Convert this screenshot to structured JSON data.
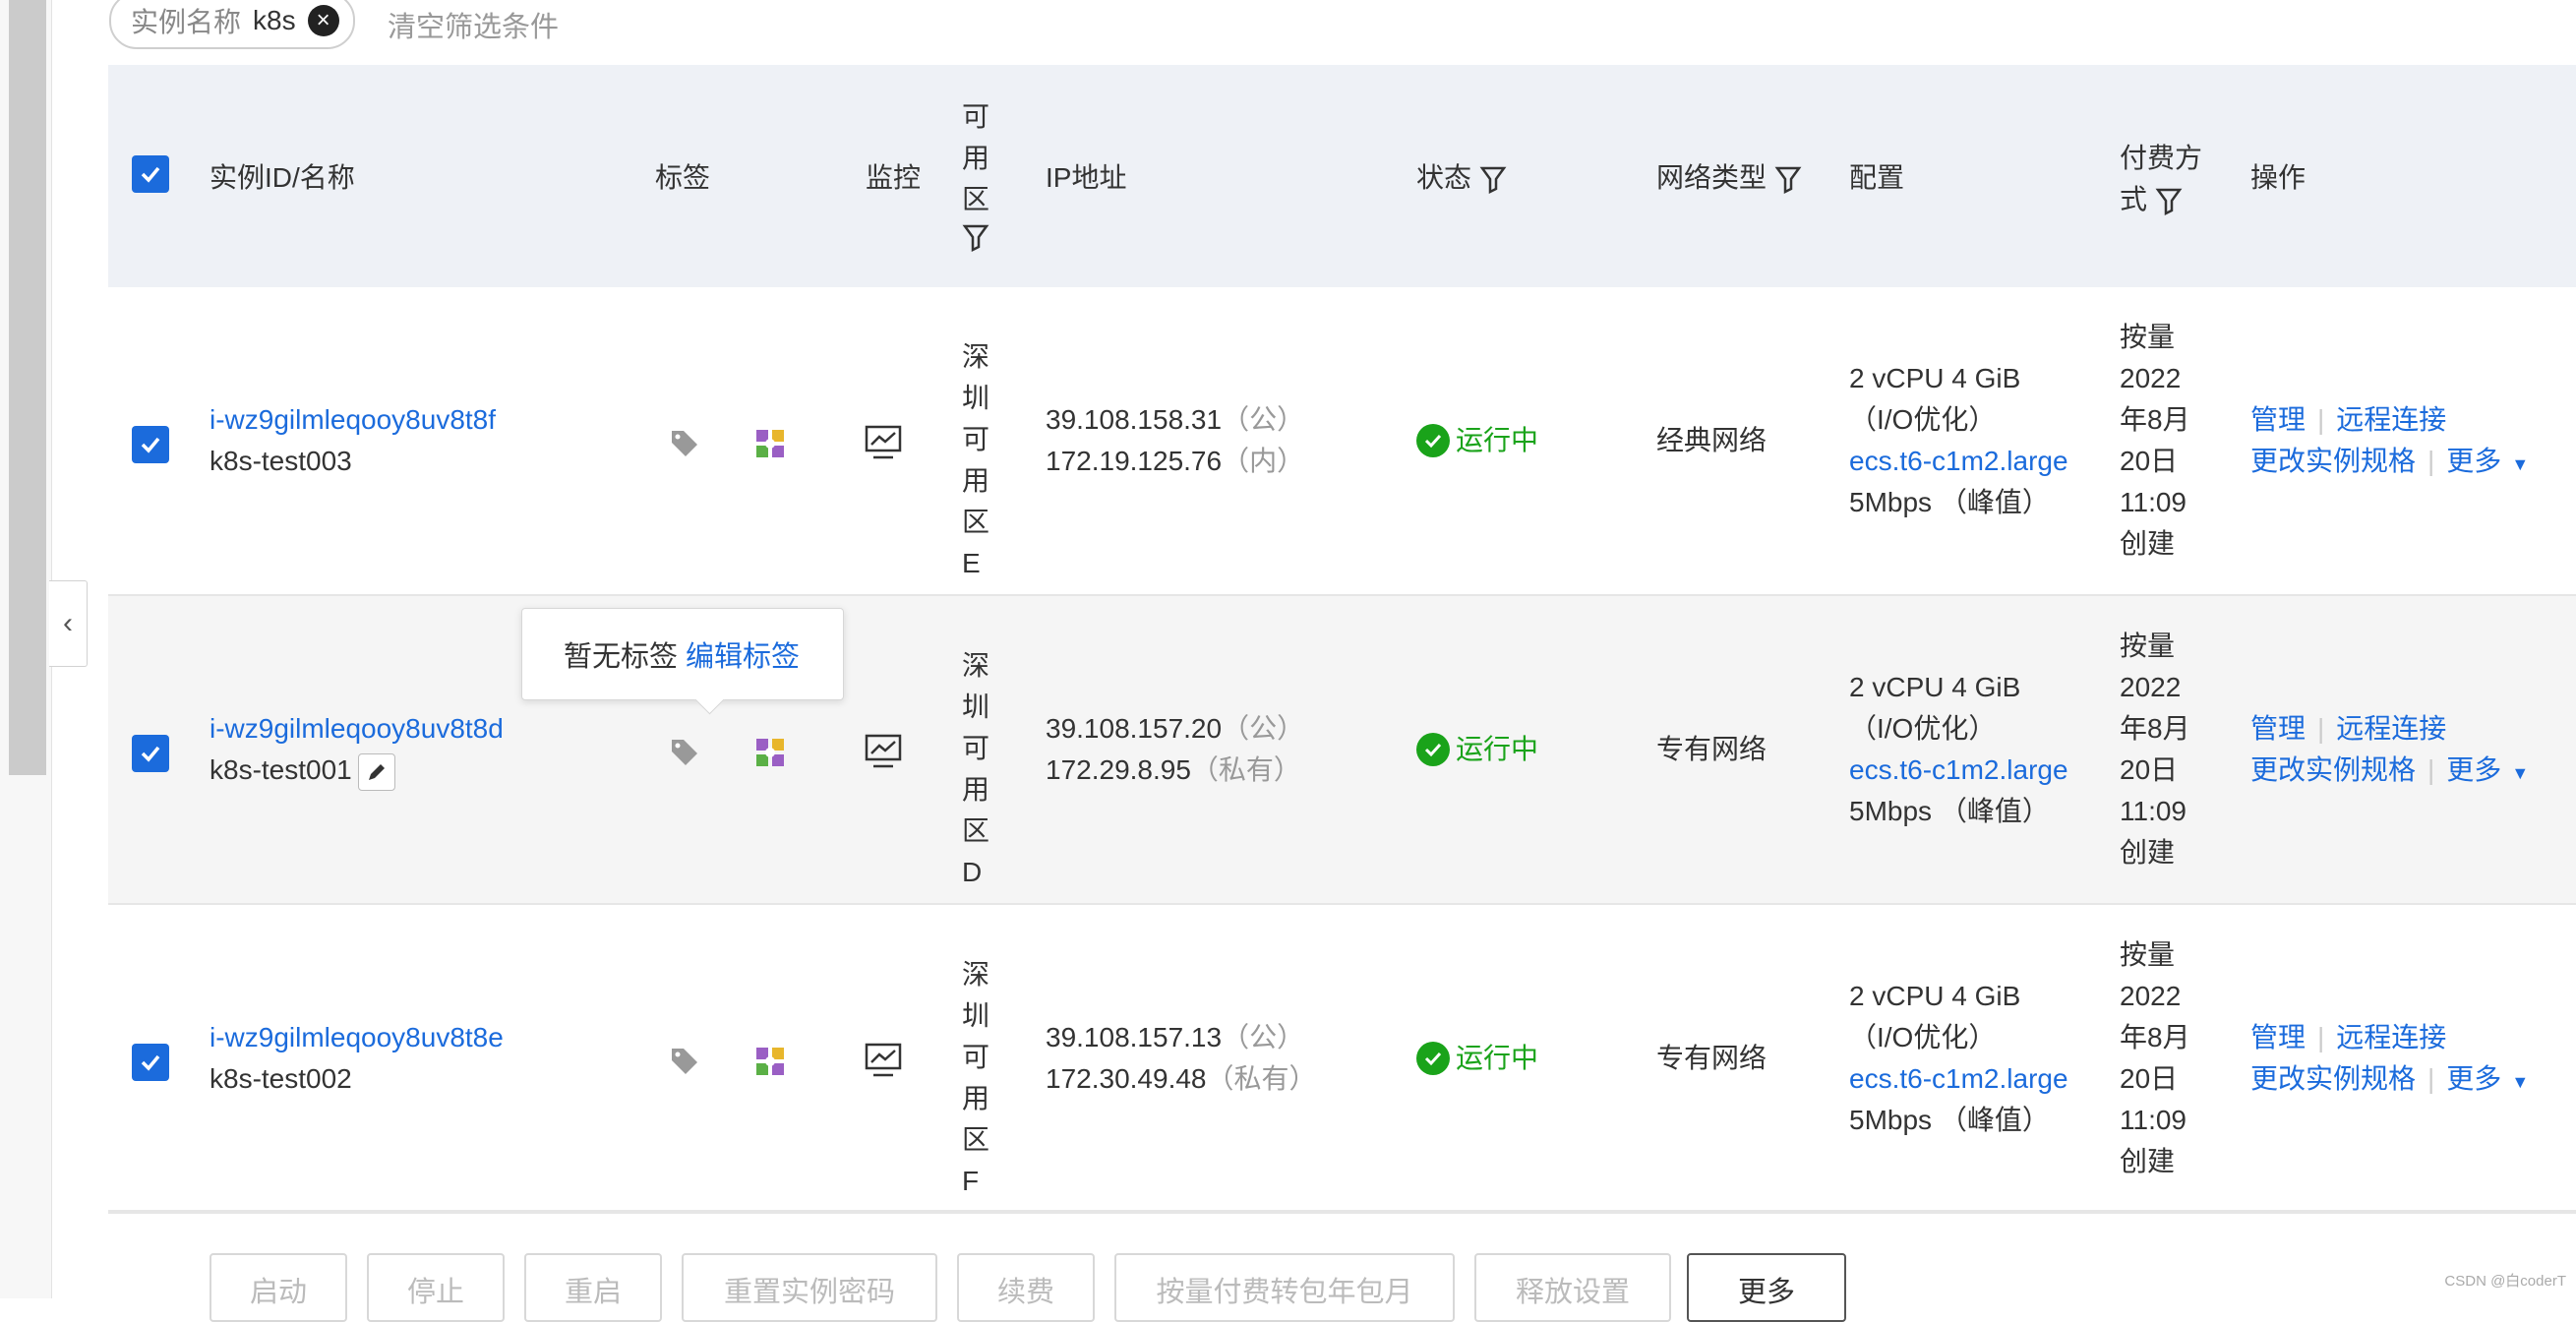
{
  "filter": {
    "key": "实例名称",
    "value": "k8s",
    "clear_label": "清空筛选条件"
  },
  "columns": {
    "id_name": "实例ID/名称",
    "tags": "标签",
    "monitor": "监控",
    "zone": "可用区",
    "ip": "IP地址",
    "status": "状态",
    "network": "网络类型",
    "config": "配置",
    "billing": "付费方式",
    "actions": "操作"
  },
  "rows": [
    {
      "id": "i-wz9gilmleqooy8uv8t8f",
      "name": "k8s-test003",
      "zone": "深圳可用区E",
      "ip_public": "39.108.158.31",
      "ip_public_tag": "（公）",
      "ip_private": "172.19.125.76",
      "ip_private_tag": "（内）",
      "status": "运行中",
      "network": "经典网络",
      "config_spec": "2 vCPU 4 GiB",
      "config_io": "（I/O优化）",
      "config_type": "ecs.t6-c1m2.large",
      "config_bw": "5Mbps （峰值）",
      "billing": "按量",
      "billing_date": "2022年8月20日",
      "billing_time": "11:09",
      "billing_created": "创建",
      "action_manage": "管理",
      "action_remote": "远程连接",
      "action_resize": "更改实例规格",
      "action_more": "更多"
    },
    {
      "id": "i-wz9gilmleqooy8uv8t8d",
      "name": "k8s-test001",
      "zone": "深圳可用区D",
      "ip_public": "39.108.157.20",
      "ip_public_tag": "（公）",
      "ip_private": "172.29.8.95",
      "ip_private_tag": "（私有）",
      "status": "运行中",
      "network": "专有网络",
      "config_spec": "2 vCPU 4 GiB",
      "config_io": "（I/O优化）",
      "config_type": "ecs.t6-c1m2.large",
      "config_bw": "5Mbps （峰值）",
      "billing": "按量",
      "billing_date": "2022年8月20日",
      "billing_time": "11:09",
      "billing_created": "创建",
      "action_manage": "管理",
      "action_remote": "远程连接",
      "action_resize": "更改实例规格",
      "action_more": "更多"
    },
    {
      "id": "i-wz9gilmleqooy8uv8t8e",
      "name": "k8s-test002",
      "zone": "深圳可用区F",
      "ip_public": "39.108.157.13",
      "ip_public_tag": "（公）",
      "ip_private": "172.30.49.48",
      "ip_private_tag": "（私有）",
      "status": "运行中",
      "network": "专有网络",
      "config_spec": "2 vCPU 4 GiB",
      "config_io": "（I/O优化）",
      "config_type": "ecs.t6-c1m2.large",
      "config_bw": "5Mbps （峰值）",
      "billing": "按量",
      "billing_date": "2022年8月20日",
      "billing_time": "11:09",
      "billing_created": "创建",
      "action_manage": "管理",
      "action_remote": "远程连接",
      "action_resize": "更改实例规格",
      "action_more": "更多"
    }
  ],
  "tooltip": {
    "text": "暂无标签",
    "link": "编辑标签"
  },
  "footer_buttons": [
    "启动",
    "停止",
    "重启",
    "重置实例密码",
    "续费",
    "按量付费转包年包月",
    "释放设置",
    "更多"
  ],
  "watermark": "CSDN @白coderT",
  "colors": {
    "primary": "#1b6bdc",
    "running": "#1aa31a",
    "header_bg": "#eef1f6"
  }
}
